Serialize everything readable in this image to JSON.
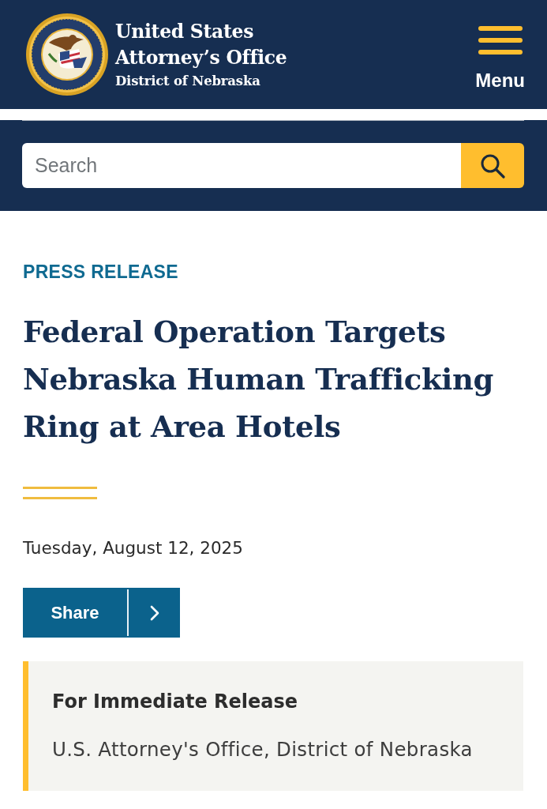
{
  "header": {
    "title": "United States Attorney’s Office",
    "subtitle": "District of Nebraska",
    "menu_label": "Menu"
  },
  "search": {
    "placeholder": "Search"
  },
  "article": {
    "category": "PRESS RELEASE",
    "headline": "Federal Operation Targets Nebraska Human Trafficking Ring at Area Hotels",
    "date": "Tuesday, August 12, 2025",
    "share_label": "Share"
  },
  "release_box": {
    "heading": "For Immediate Release",
    "source": "U.S. Attorney's Office, District of Nebraska"
  }
}
